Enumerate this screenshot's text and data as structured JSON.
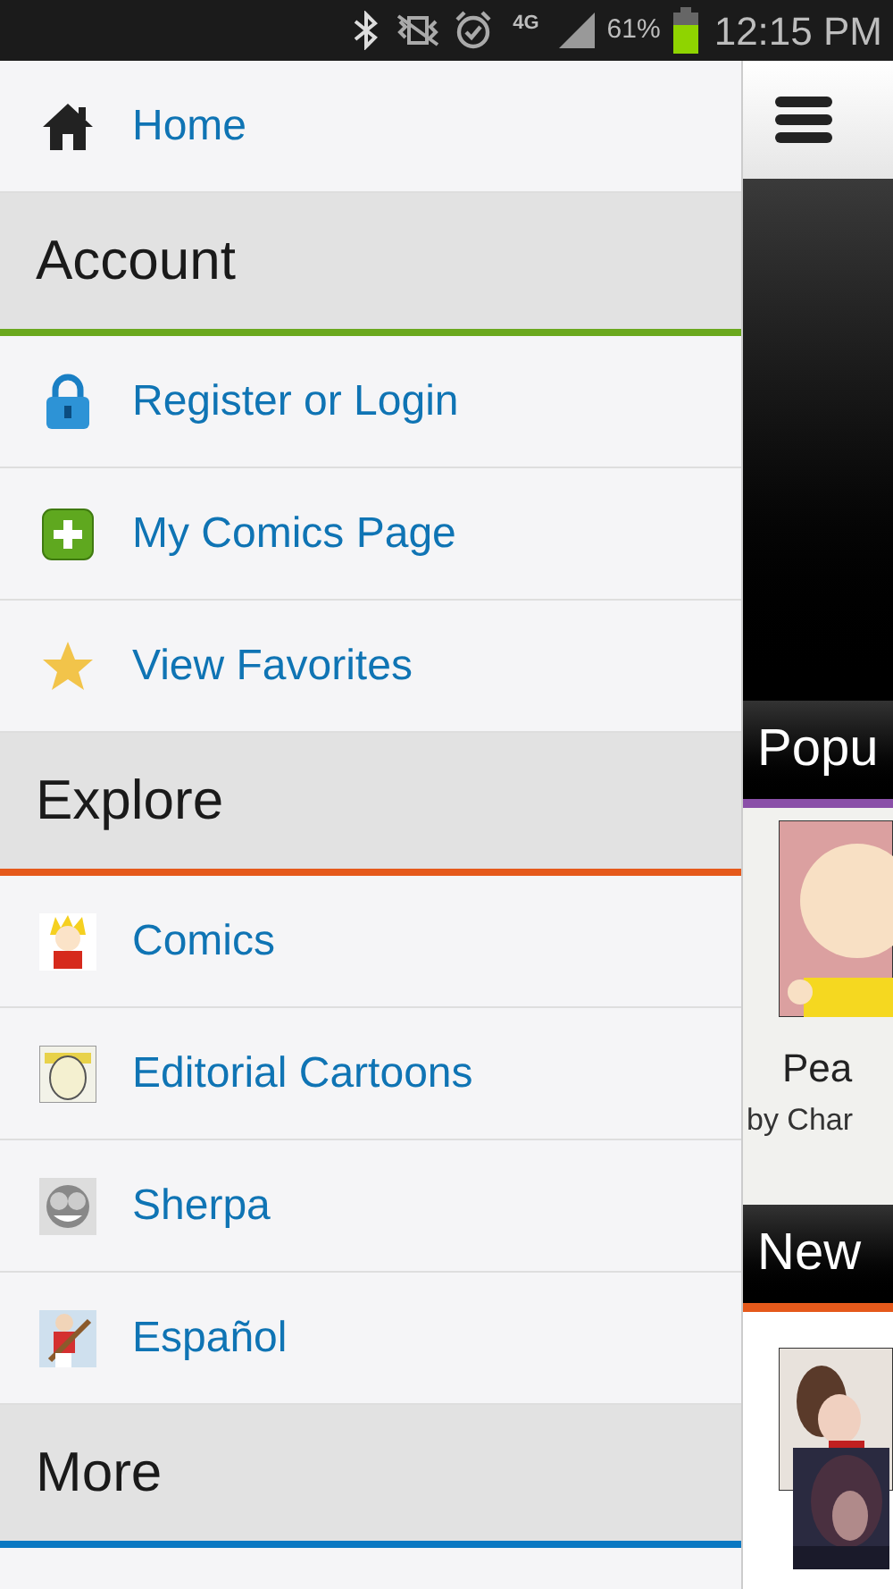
{
  "status_bar": {
    "network": "4G",
    "battery": "61%",
    "time": "12:15 PM"
  },
  "drawer": [
    {
      "kind": "item",
      "label": "Home"
    },
    {
      "kind": "section",
      "label": "Account",
      "color": "#6aa81e"
    },
    {
      "kind": "item",
      "label": "Register or Login"
    },
    {
      "kind": "item",
      "label": "My Comics Page"
    },
    {
      "kind": "item",
      "label": "View Favorites"
    },
    {
      "kind": "section",
      "label": "Explore",
      "color": "#e5591b"
    },
    {
      "kind": "item",
      "label": "Comics"
    },
    {
      "kind": "item",
      "label": "Editorial Cartoons"
    },
    {
      "kind": "item",
      "label": "Sherpa"
    },
    {
      "kind": "item",
      "label": "Español"
    },
    {
      "kind": "section",
      "label": "More",
      "color": "#0a78c2"
    }
  ],
  "main": {
    "popular": {
      "title": "Popu",
      "color": "#8a4fa8",
      "card_title": "Pea",
      "card_byline": "by Char"
    },
    "newest": {
      "title": "New",
      "color": "#e5591b"
    }
  }
}
